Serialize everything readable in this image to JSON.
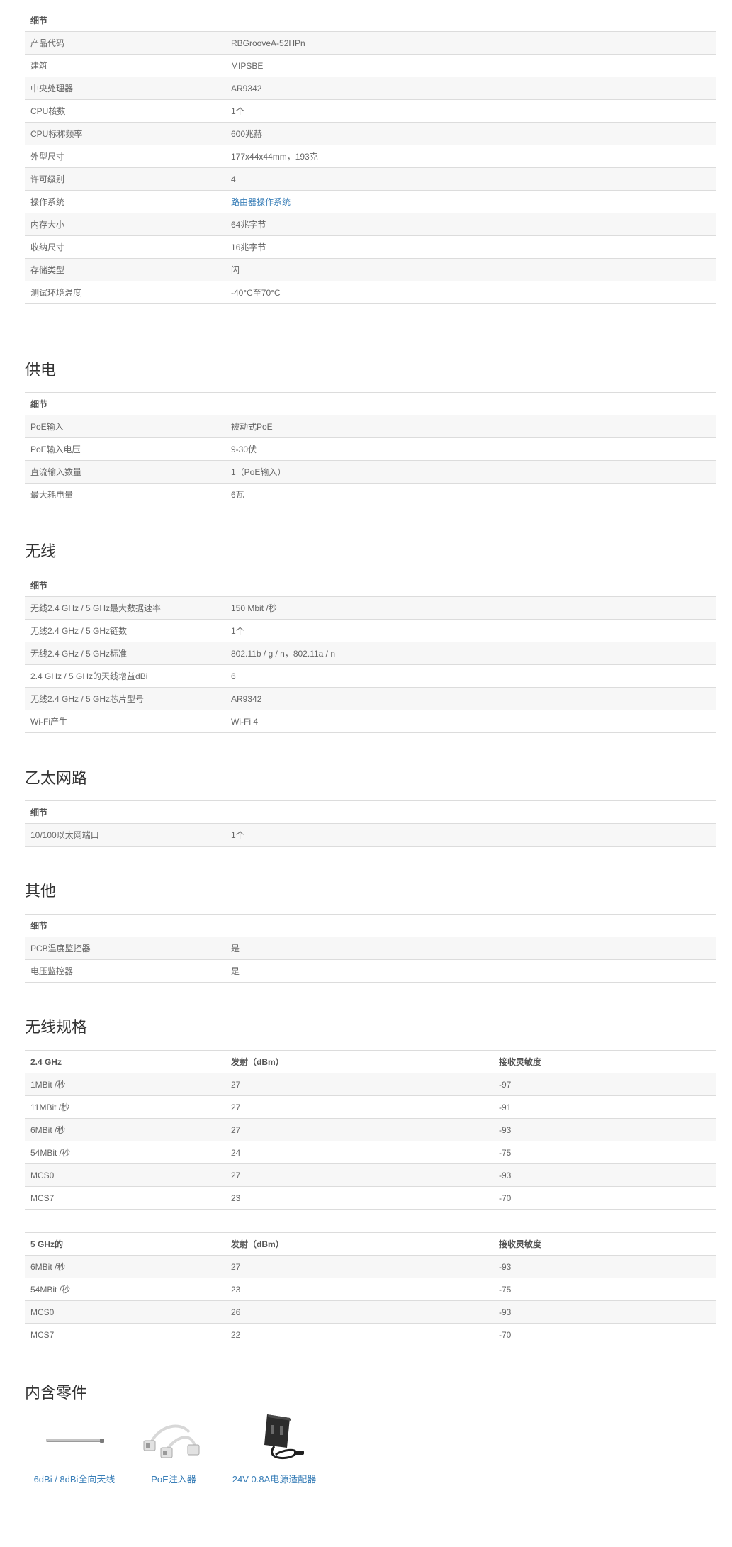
{
  "details_header": "细节",
  "general": {
    "rows": [
      [
        "产品代码",
        "RBGrooveA-52HPn"
      ],
      [
        "建筑",
        "MIPSBE"
      ],
      [
        "中央处理器",
        "AR9342"
      ],
      [
        "CPU核数",
        "1个"
      ],
      [
        "CPU标称频率",
        "600兆赫"
      ],
      [
        "外型尺寸",
        "177x44x44mm，193克"
      ],
      [
        "许可级别",
        "4"
      ],
      [
        "操作系统",
        "路由器操作系统"
      ],
      [
        "内存大小",
        "64兆字节"
      ],
      [
        "收纳尺寸",
        "16兆字节"
      ],
      [
        "存储类型",
        "闪"
      ],
      [
        "测试环境温度",
        "-40°C至70°C"
      ]
    ]
  },
  "power": {
    "title": "供电",
    "rows": [
      [
        "PoE输入",
        "被动式PoE"
      ],
      [
        "PoE输入电压",
        "9-30伏"
      ],
      [
        "直流输入数量",
        "1（PoE输入）"
      ],
      [
        "最大耗电量",
        "6瓦"
      ]
    ]
  },
  "wireless": {
    "title": "无线",
    "rows": [
      [
        "无线2.4 GHz / 5 GHz最大数据速率",
        "150 Mbit /秒"
      ],
      [
        "无线2.4 GHz / 5 GHz链数",
        "1个"
      ],
      [
        "无线2.4 GHz / 5 GHz标准",
        "802.11b / g / n，802.11a / n"
      ],
      [
        "2.4 GHz / 5 GHz的天线增益dBi",
        "6"
      ],
      [
        "无线2.4 GHz / 5 GHz芯片型号",
        "AR9342"
      ],
      [
        "Wi-Fi产生",
        "Wi-Fi 4"
      ]
    ]
  },
  "ethernet": {
    "title": "乙太网路",
    "rows": [
      [
        "10/100以太网端口",
        "1个"
      ]
    ]
  },
  "other": {
    "title": "其他",
    "rows": [
      [
        "PCB温度监控器",
        "是"
      ],
      [
        "电压监控器",
        "是"
      ]
    ]
  },
  "wireless_specs": {
    "title": "无线规格",
    "tx_header": "发射（dBm）",
    "rx_header": "接收灵敏度",
    "band24": {
      "label": "2.4 GHz",
      "rows": [
        [
          "1MBit /秒",
          "27",
          "-97"
        ],
        [
          "11MBit /秒",
          "27",
          "-91"
        ],
        [
          "6MBit /秒",
          "27",
          "-93"
        ],
        [
          "54MBit /秒",
          "24",
          "-75"
        ],
        [
          "MCS0",
          "27",
          "-93"
        ],
        [
          "MCS7",
          "23",
          "-70"
        ]
      ]
    },
    "band5": {
      "label": "5 GHz的",
      "rows": [
        [
          "6MBit /秒",
          "27",
          "-93"
        ],
        [
          "54MBit /秒",
          "23",
          "-75"
        ],
        [
          "MCS0",
          "26",
          "-93"
        ],
        [
          "MCS7",
          "22",
          "-70"
        ]
      ]
    }
  },
  "included_parts": {
    "title": "内含零件",
    "items": [
      {
        "label": "6dBi / 8dBi全向天线",
        "icon": "antenna-icon"
      },
      {
        "label": "PoE注入器",
        "icon": "poe-injector-icon"
      },
      {
        "label": "24V 0.8A电源适配器",
        "icon": "power-adapter-icon"
      }
    ]
  },
  "colors": {
    "link": "#3a7fb8",
    "row_stripe": "#f7f7f7",
    "border": "#dcdcdc"
  }
}
